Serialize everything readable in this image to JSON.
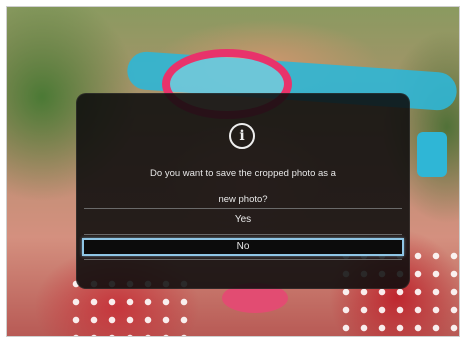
{
  "dialog": {
    "icon": "info-icon",
    "icon_glyph": "i",
    "message_line1": "Do you want to save the cropped photo as a",
    "message_line2": "new photo?",
    "options": [
      {
        "label": "Yes",
        "selected": false
      },
      {
        "label": "No",
        "selected": true
      }
    ]
  },
  "colors": {
    "dialog_bg": "#0c0c0c",
    "selection_border": "#8fc6e6",
    "text": "#e8e8e8"
  }
}
